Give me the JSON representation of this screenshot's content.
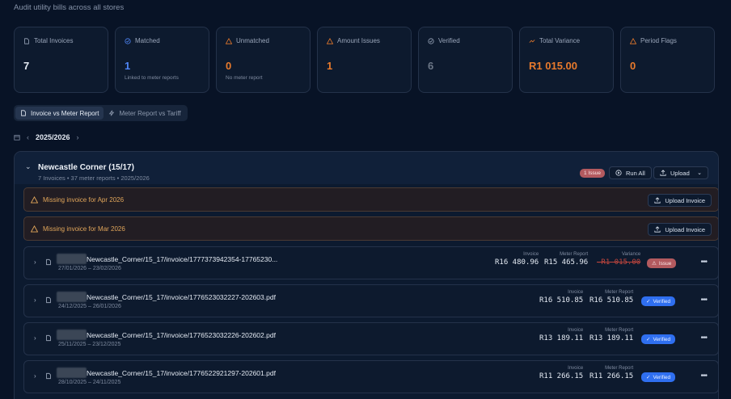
{
  "page": {
    "subtitle": "Audit utility bills across all stores"
  },
  "cards": [
    {
      "title": "Total Invoices",
      "value": "7",
      "sub": "",
      "icon": "document-icon",
      "color": "#e4eaf3"
    },
    {
      "title": "Matched",
      "value": "1",
      "sub": "Linked to meter reports",
      "icon": "check-circle-icon",
      "color": "#4f86f7"
    },
    {
      "title": "Unmatched",
      "value": "0",
      "sub": "No meter report",
      "icon": "warning-icon",
      "color": "#e87a2c"
    },
    {
      "title": "Amount Issues",
      "value": "1",
      "sub": "",
      "icon": "warning-icon",
      "color": "#e87a2c"
    },
    {
      "title": "Verified",
      "value": "6",
      "sub": "",
      "icon": "check-circle-icon",
      "color": "#6b7686"
    },
    {
      "title": "Total Variance",
      "value": "R1 015.00",
      "sub": "",
      "icon": "trend-icon",
      "color": "#e87a2c"
    },
    {
      "title": "Period Flags",
      "value": "0",
      "sub": "",
      "icon": "warning-icon",
      "color": "#e87a2c"
    }
  ],
  "toggle": {
    "option1": "Invoice vs Meter Report",
    "option2": "Meter Report vs Tariff"
  },
  "period": {
    "label": "2025/2026"
  },
  "store": {
    "title": "Newcastle Corner (15/17)",
    "meta": "7 Invoices • 37 meter reports • 2025/2026",
    "issue_badge": "1 Issue",
    "run_all": "Run All",
    "upload": "Upload"
  },
  "alerts": [
    {
      "text": "Missing invoice for Apr 2026",
      "button": "Upload Invoice"
    },
    {
      "text": "Missing invoice for Mar 2026",
      "button": "Upload Invoice"
    }
  ],
  "invoice_labels": {
    "invoice": "Invoice",
    "meter_report": "Meter Report",
    "variance": "Variance"
  },
  "invoices": [
    {
      "name": "Newcastle_Corner/15_17/invoice/1777373942354-17765230...",
      "dates": "27/01/2026 – 23/02/2026",
      "invoice": "R16 480.96",
      "meter": "R15 465.96",
      "variance": "-R1 015.00",
      "status": "Issue"
    },
    {
      "name": "Newcastle_Corner/15_17/invoice/1776523032227-202603.pdf",
      "dates": "24/12/2025 – 26/01/2026",
      "invoice": "R16 510.85",
      "meter": "R16 510.85",
      "variance": "",
      "status": "Verified"
    },
    {
      "name": "Newcastle_Corner/15_17/invoice/1776523032226-202602.pdf",
      "dates": "25/11/2025 – 23/12/2025",
      "invoice": "R13 189.11",
      "meter": "R13 189.11",
      "variance": "",
      "status": "Verified"
    },
    {
      "name": "Newcastle_Corner/15_17/invoice/1776522921297-202601.pdf",
      "dates": "28/10/2025 – 24/11/2025",
      "invoice": "R11 266.15",
      "meter": "R11 266.15",
      "variance": "",
      "status": "Verified"
    }
  ]
}
